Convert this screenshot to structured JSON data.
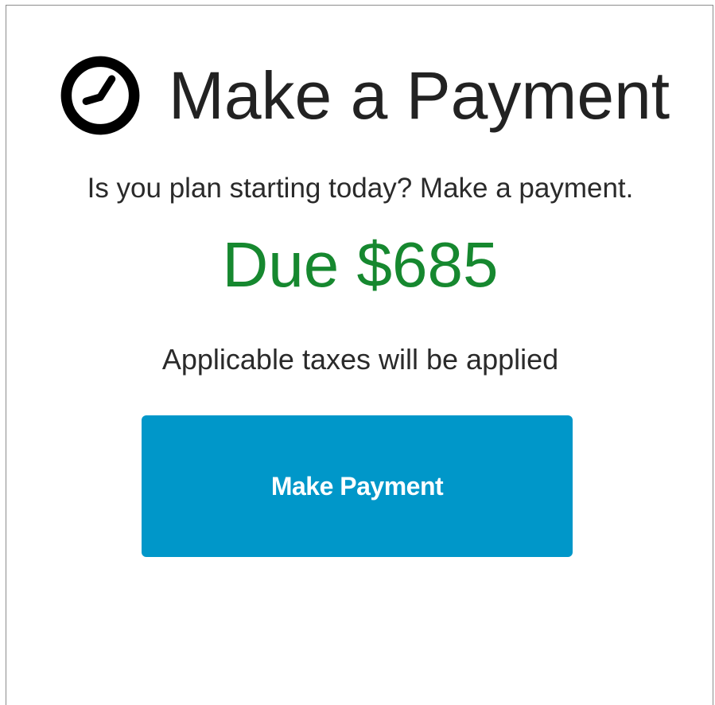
{
  "header": {
    "icon": "clock-icon",
    "title": "Make a Payment"
  },
  "content": {
    "subtitle": "Is you plan starting today? Make a payment.",
    "amount_due": "Due $685",
    "tax_note": "Applicable taxes will be applied"
  },
  "actions": {
    "make_payment_label": "Make Payment"
  },
  "colors": {
    "amount_color": "#16882f",
    "button_color": "#0097c9",
    "text_color": "#222222"
  }
}
